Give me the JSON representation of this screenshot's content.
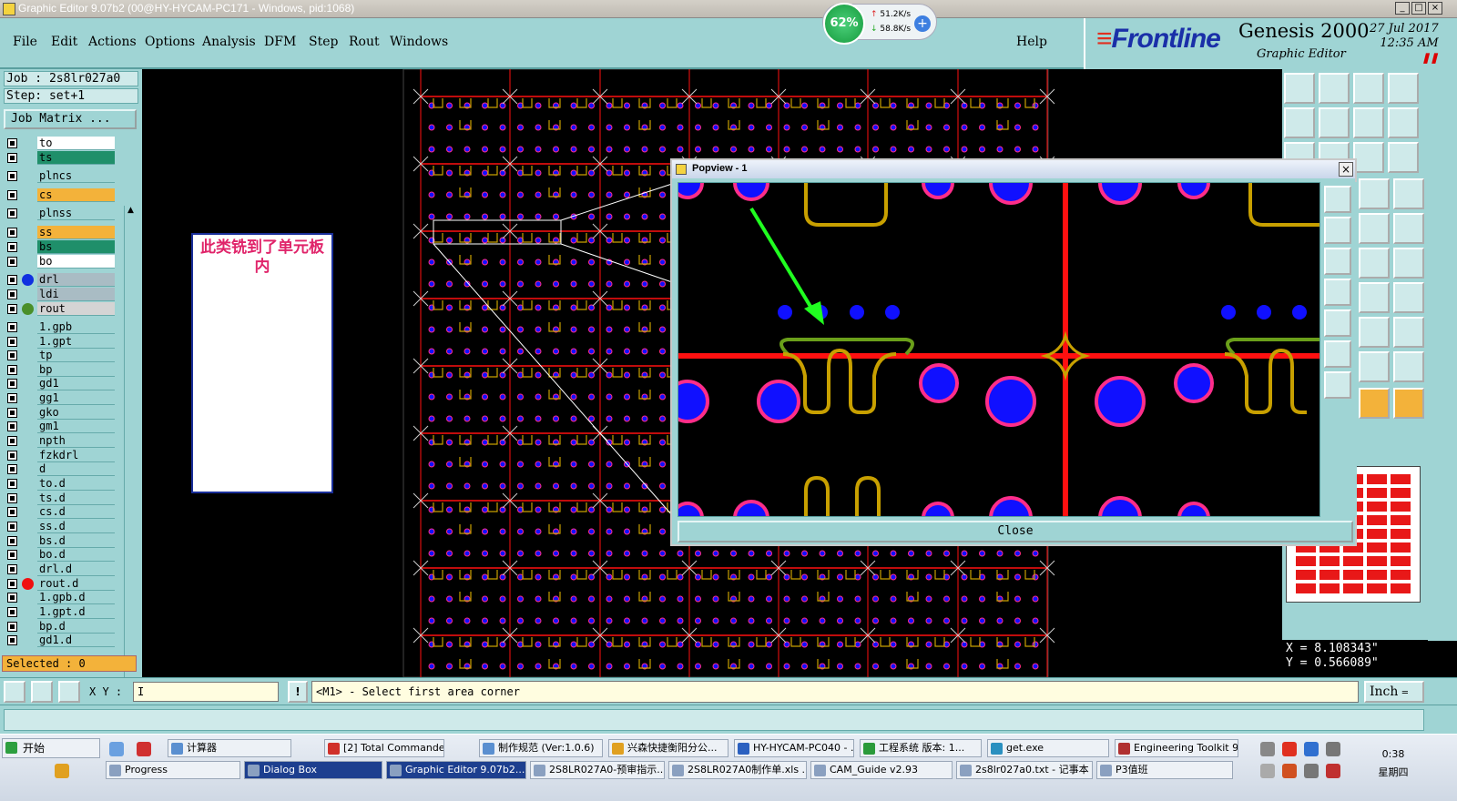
{
  "window": {
    "title": "Graphic Editor 9.07b2 (00@HY-HYCAM-PC171 - Windows, pid:1068)"
  },
  "menu": {
    "items": [
      "File",
      "Edit",
      "Actions",
      "Options",
      "Analysis",
      "DFM",
      "Step",
      "Rout",
      "Windows"
    ],
    "help": "Help"
  },
  "brand": {
    "logo": "Frontline",
    "product": "Genesis 2000",
    "subtitle": "Graphic Editor",
    "date": "27 Jul 2017",
    "time": "12:35 AM"
  },
  "network": {
    "percent": "62%",
    "up": "51.2K/s",
    "down": "58.8K/s",
    "add_icon": "plus-icon"
  },
  "job": {
    "job_line": "Job : 2s8lr027a0",
    "step_line": "Step: set+1",
    "matrix_button": "Job Matrix ..."
  },
  "layers": [
    {
      "name": "to",
      "color": "#ffffff"
    },
    {
      "name": "ts",
      "color": "#1f8f6a"
    },
    {
      "name": "plncs",
      "color": "#9fd4d4"
    },
    {
      "name": "cs",
      "color": "#f3b23a"
    },
    {
      "name": "plnss",
      "color": "#9fd4d4"
    },
    {
      "name": "ss",
      "color": "#f3b23a"
    },
    {
      "name": "bs",
      "color": "#1f8f6a"
    },
    {
      "name": "bo",
      "color": "#ffffff"
    },
    {
      "name": "drl",
      "color": "#a9bcc4",
      "dot": "#1030e0"
    },
    {
      "name": "ldi",
      "color": "#a9bcc4"
    },
    {
      "name": "rout",
      "color": "#d4d4d4",
      "dot": "#4a8f2a"
    },
    {
      "name": "1.gpb",
      "color": "#9fd4d4"
    },
    {
      "name": "1.gpt",
      "color": "#9fd4d4"
    },
    {
      "name": "tp",
      "color": "#9fd4d4"
    },
    {
      "name": "bp",
      "color": "#9fd4d4"
    },
    {
      "name": "gd1",
      "color": "#9fd4d4"
    },
    {
      "name": "gg1",
      "color": "#9fd4d4"
    },
    {
      "name": "gko",
      "color": "#9fd4d4"
    },
    {
      "name": "gm1",
      "color": "#9fd4d4"
    },
    {
      "name": "npth",
      "color": "#9fd4d4"
    },
    {
      "name": "fzkdrl",
      "color": "#9fd4d4"
    },
    {
      "name": "d",
      "color": "#9fd4d4"
    },
    {
      "name": "to.d",
      "color": "#9fd4d4"
    },
    {
      "name": "ts.d",
      "color": "#9fd4d4"
    },
    {
      "name": "cs.d",
      "color": "#9fd4d4"
    },
    {
      "name": "ss.d",
      "color": "#9fd4d4"
    },
    {
      "name": "bs.d",
      "color": "#9fd4d4"
    },
    {
      "name": "bo.d",
      "color": "#9fd4d4"
    },
    {
      "name": "drl.d",
      "color": "#9fd4d4"
    },
    {
      "name": "rout.d",
      "color": "#9fd4d4",
      "dot": "#f01010"
    },
    {
      "name": "1.gpb.d",
      "color": "#9fd4d4"
    },
    {
      "name": "1.gpt.d",
      "color": "#9fd4d4"
    },
    {
      "name": "bp.d",
      "color": "#9fd4d4"
    },
    {
      "name": "gd1.d",
      "color": "#9fd4d4"
    }
  ],
  "selected": "Selected : 0",
  "annotation": "此类铣到了单元板内",
  "popview": {
    "title": "Popview - 1",
    "close_label": "Close"
  },
  "coords": {
    "x": "X = 8.108343\"",
    "y": "Y = 0.566089\""
  },
  "command": {
    "xy_label": "X Y :",
    "xy_value": "I",
    "prompt": "<M1> - Select first area corner",
    "unit": "Inch"
  },
  "taskbar": {
    "start": "开始",
    "row1": [
      "计算器",
      "[2] Total Commande...",
      "制作规范 (Ver:1.0.6)",
      "兴森快捷衡阳分公...",
      "HY-HYCAM-PC040 - ...",
      "工程系统  版本: 1...",
      "get.exe",
      "Engineering Toolkit 9..."
    ],
    "row2": [
      "Progress",
      "Dialog Box",
      "Graphic Editor 9.07b2...",
      "2S8LR027A0-预审指示...",
      "2S8LR027A0制作单.xls ...",
      "CAM_Guide v2.93",
      "2s8lr027a0.txt - 记事本",
      "P3值班"
    ],
    "time": "0:38",
    "day": "星期四"
  },
  "colors": {
    "panel": "#9fd4d4",
    "pad": "#1010ff",
    "pad_ring": "#ff2d8a",
    "rout_line": "#ff1010",
    "rout_cut": "#c8a000",
    "arrow": "#20ff20"
  }
}
